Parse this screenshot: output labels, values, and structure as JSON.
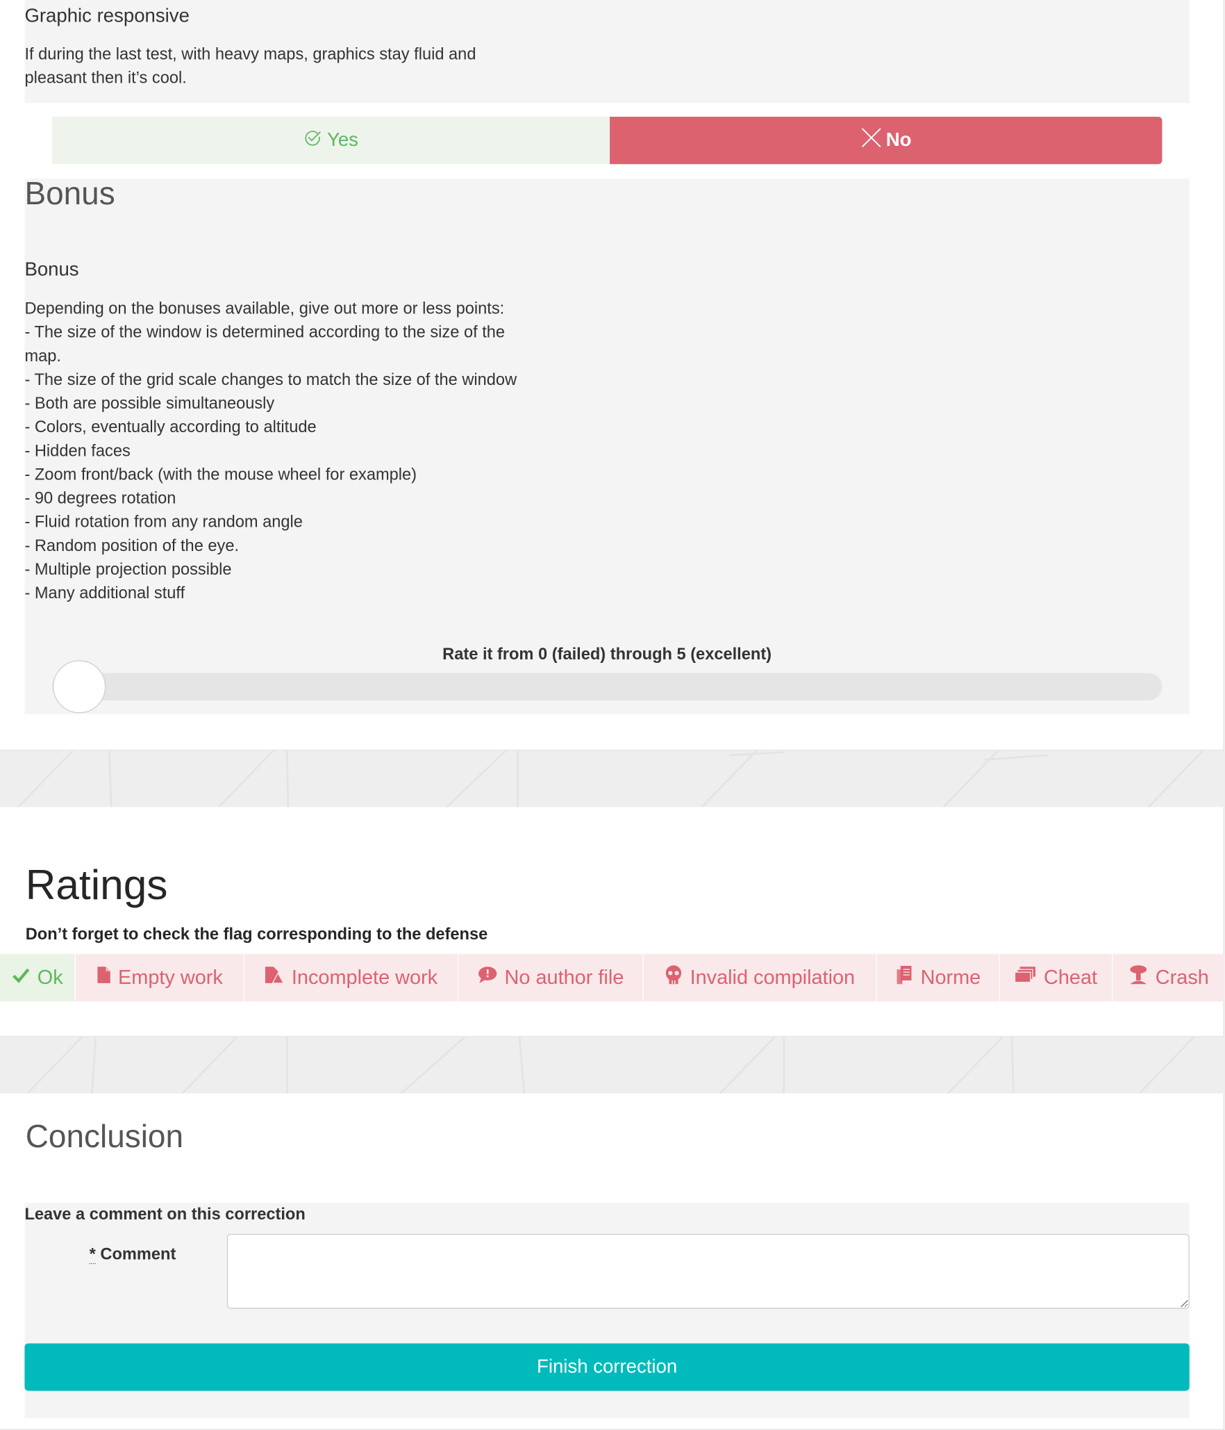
{
  "graphic_question": {
    "title": "Graphic responsive",
    "description_lines": [
      "If during the last test, with heavy maps, graphics stay fluid and",
      "pleasant then it’s cool."
    ],
    "yes_label": "Yes",
    "no_label": "No",
    "selected": "No",
    "icons": {
      "yes": "check-circle-icon",
      "no": "close-icon"
    }
  },
  "bonus_section": {
    "title": "Bonus",
    "question_title": "Bonus",
    "description_lines": [
      "Depending on the bonuses available, give out more or less points:",
      "- The size of the window is determined according to the size of the",
      "map.",
      "- The size of the grid scale changes to match the size of the window",
      "- Both are possible simultaneously",
      "- Colors, eventually according to altitude",
      "- Hidden faces",
      "- Zoom front/back (with the mouse wheel for example)",
      "- 90 degrees rotation",
      "- Fluid rotation from any random angle",
      "- Random position of the eye.",
      "- Multiple projection possible",
      "- Many additional stuff"
    ],
    "rate_label": "Rate it from 0 (failed) through 5 (excellent)",
    "rating_min": 0,
    "rating_max": 5,
    "rating_value": 0
  },
  "ratings": {
    "title": "Ratings",
    "subtitle": "Don’t forget to check the flag corresponding to the defense",
    "flags": [
      {
        "label": "Ok",
        "icon": "checkmark-icon"
      },
      {
        "label": "Empty work",
        "icon": "file-icon"
      },
      {
        "label": "Incomplete work",
        "icon": "incomplete-file-icon"
      },
      {
        "label": "No author file",
        "icon": "speech-bubble-icon"
      },
      {
        "label": "Invalid compilation",
        "icon": "skull-icon"
      },
      {
        "label": "Norme",
        "icon": "book-icon"
      },
      {
        "label": "Cheat",
        "icon": "cards-icon"
      },
      {
        "label": "Crash",
        "icon": "explosion-icon"
      }
    ],
    "colors": {
      "ok_text": "#5cb85c",
      "ok_bg": "#e9f3e6",
      "flag_text": "#dc6270",
      "flag_bg": "#f9e9ea"
    }
  },
  "conclusion": {
    "title": "Conclusion",
    "legend": "Leave a comment on this correction",
    "comment_required_mark": "*",
    "comment_label": "Comment",
    "comment_value": "",
    "finish_button": "Finish correction",
    "accent_color": "#00babc"
  }
}
